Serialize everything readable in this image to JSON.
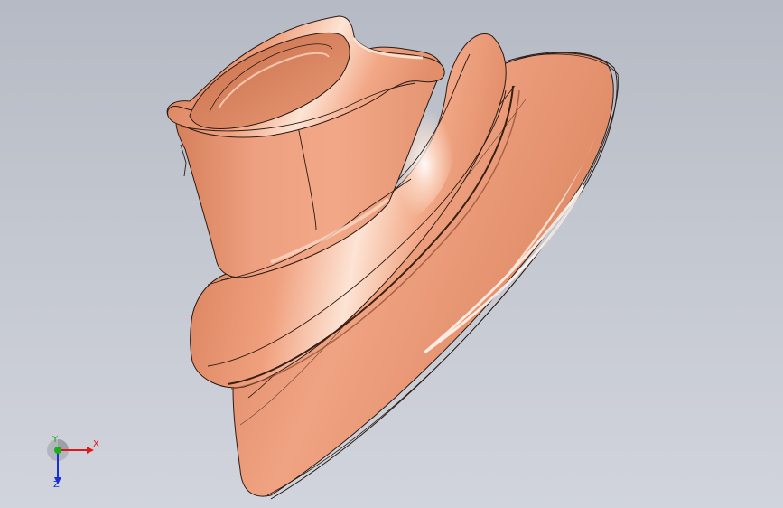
{
  "colors": {
    "background_top": "#b6bac4",
    "background_bottom": "#d1d4dc",
    "part_base": "#e7906c",
    "part_highlight": "#fde4d4",
    "part_shadow": "#b8603d",
    "edge": "#2a1a14",
    "axis_x": "#e01818",
    "axis_y": "#18b018",
    "axis_z": "#1830d8"
  },
  "triad": {
    "x_label": "X",
    "y_label": "Y",
    "z_label": "Z"
  },
  "icons": {
    "triad": "coordinate-triad-icon"
  }
}
